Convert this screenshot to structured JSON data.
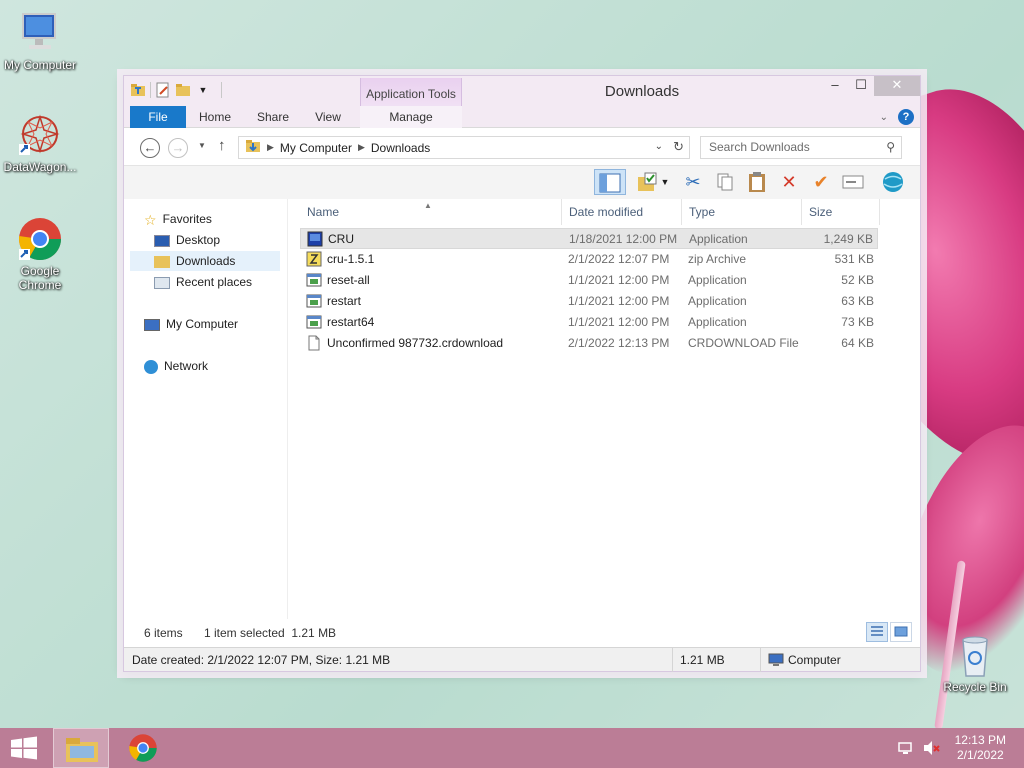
{
  "desktop": {
    "icons": [
      {
        "label": "My Computer"
      },
      {
        "label": "DataWagon..."
      },
      {
        "label": "Google Chrome"
      },
      {
        "label": "Recycle Bin"
      }
    ]
  },
  "window": {
    "title": "Downloads",
    "context_tab_title": "Application Tools",
    "ribbon_tabs": [
      "File",
      "Home",
      "Share",
      "View",
      "Manage"
    ],
    "address": {
      "segments": [
        "My Computer",
        "Downloads"
      ]
    },
    "search_placeholder": "Search Downloads"
  },
  "navpane": {
    "favorites": "Favorites",
    "desktop": "Desktop",
    "downloads": "Downloads",
    "recent": "Recent places",
    "computer": "My Computer",
    "network": "Network"
  },
  "columns": [
    "Name",
    "Date modified",
    "Type",
    "Size"
  ],
  "files": [
    {
      "name": "CRU",
      "date": "1/18/2021 12:00 PM",
      "type": "Application",
      "size": "1,249 KB",
      "icon": "app-icon"
    },
    {
      "name": "cru-1.5.1",
      "date": "2/1/2022 12:07 PM",
      "type": "zip Archive",
      "size": "531 KB",
      "icon": "zip-icon"
    },
    {
      "name": "reset-all",
      "date": "1/1/2021 12:00 PM",
      "type": "Application",
      "size": "52 KB",
      "icon": "app-icon"
    },
    {
      "name": "restart",
      "date": "1/1/2021 12:00 PM",
      "type": "Application",
      "size": "63 KB",
      "icon": "app-icon"
    },
    {
      "name": "restart64",
      "date": "1/1/2021 12:00 PM",
      "type": "Application",
      "size": "73 KB",
      "icon": "app-icon"
    },
    {
      "name": "Unconfirmed 987732.crdownload",
      "date": "2/1/2022 12:13 PM",
      "type": "CRDOWNLOAD File",
      "size": "64 KB",
      "icon": "file-icon"
    }
  ],
  "status": {
    "item_count": "6 items",
    "selected": "1 item selected  1.21 MB",
    "details": "Date created: 2/1/2022 12:07 PM, Size: 1.21 MB",
    "size": "1.21 MB",
    "location": "Computer"
  },
  "taskbar": {
    "time": "12:13 PM",
    "date": "2/1/2022"
  },
  "colors": {
    "file_tab": "#1979ca",
    "taskbar": "#bb7d96",
    "context_tab": "#e9d0ef"
  }
}
